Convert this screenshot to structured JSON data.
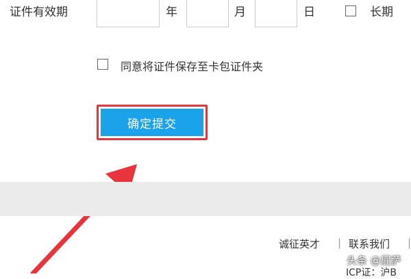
{
  "form": {
    "validity_label": "证件有效期",
    "year_unit": "年",
    "month_unit": "月",
    "day_unit": "日",
    "year_value": "",
    "month_value": "",
    "day_value": "",
    "long_term_label": "长期",
    "long_term_checked": false,
    "save_to_wallet_label": "同意将证件保存至卡包证件夹",
    "save_to_wallet_checked": false,
    "submit_label": "确定提交"
  },
  "footer": {
    "links": [
      "诚征英才",
      "联系我们"
    ],
    "separator": "|",
    "icp_partial": "ICP证：沪B"
  },
  "watermark": "头条 @屁萨",
  "colors": {
    "submit_bg": "#1aa3e8",
    "highlight_border": "#e8343d",
    "annotation_arrow": "#e8343d",
    "footer_band": "#ebebeb"
  }
}
